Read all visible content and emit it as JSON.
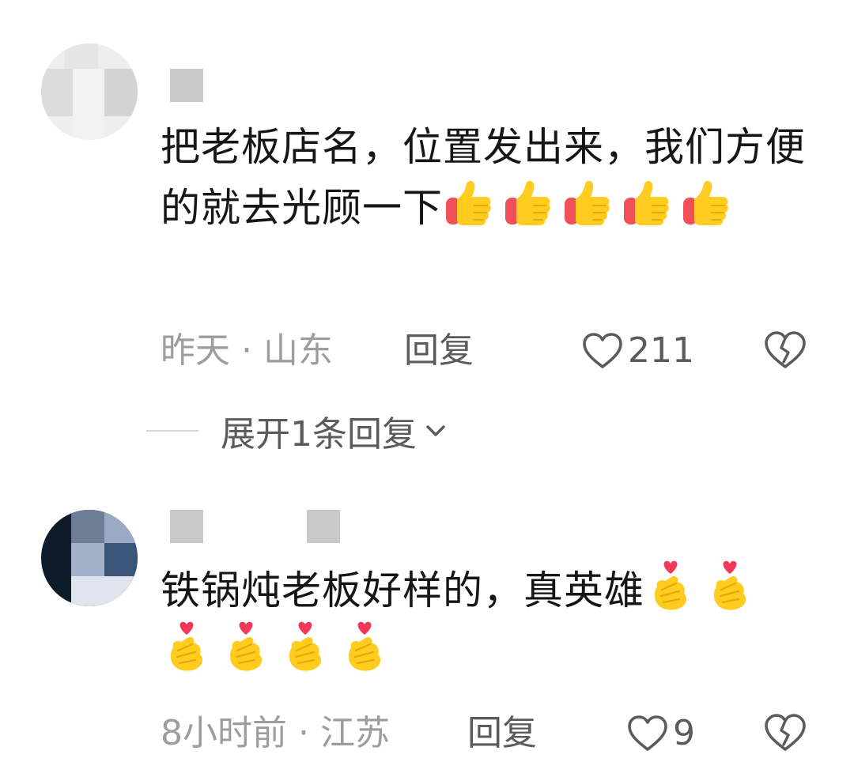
{
  "comments": [
    {
      "text": "把老板店名，位置发出来，我们方便的就去光顾一下",
      "emoji_icon": "thumbs-up-icon",
      "emoji_count": 5,
      "time": "昨天",
      "separator": "·",
      "location": "山东",
      "reply_label": "回复",
      "likes": "211"
    },
    {
      "text": "铁锅炖老板好样的，真英雄",
      "emoji_icon": "finger-heart-icon",
      "emoji_count": 6,
      "time": "8小时前",
      "separator": "·",
      "location": "江苏",
      "reply_label": "回复",
      "likes": "9"
    }
  ],
  "expand_replies": {
    "label": "展开1条回复"
  },
  "colors": {
    "text": "#161616",
    "meta": "#9d9d9d",
    "action": "#5b5b5b",
    "emoji_yellow": "#ffcc1f",
    "emoji_cuff": "#f0505a",
    "heart": "#f2385a"
  }
}
